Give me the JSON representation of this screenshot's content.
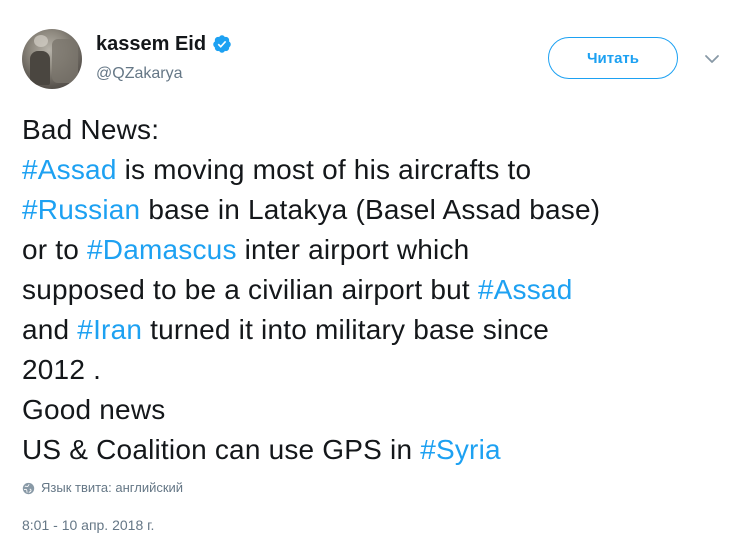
{
  "user": {
    "name": "kassem Eid",
    "handle": "@QZakarya"
  },
  "follow_button_label": "Читать",
  "tweet_lines": [
    [
      {
        "t": "Bad News:"
      }
    ],
    [
      {
        "t": "#Assad",
        "tag": true
      },
      {
        "t": " is moving most of his aircrafts to"
      }
    ],
    [
      {
        "t": "#Russian",
        "tag": true
      },
      {
        "t": " base in Latakya (Basel Assad base)"
      }
    ],
    [
      {
        "t": "or to "
      },
      {
        "t": "#Damascus",
        "tag": true
      },
      {
        "t": " inter airport which"
      }
    ],
    [
      {
        "t": "supposed to be a civilian airport but "
      },
      {
        "t": "#Assad",
        "tag": true
      }
    ],
    [
      {
        "t": "and "
      },
      {
        "t": "#Iran",
        "tag": true
      },
      {
        "t": " turned it into military base since"
      }
    ],
    [
      {
        "t": "2012 ."
      }
    ],
    [
      {
        "t": "Good news"
      }
    ],
    [
      {
        "t": "US & Coalition can use GPS in "
      },
      {
        "t": "#Syria",
        "tag": true
      }
    ]
  ],
  "language_note": "Язык твита: английский",
  "timestamp": "8:01 - 10 апр. 2018 г.",
  "colors": {
    "accent": "#1da1f2",
    "text": "#14171a",
    "secondary": "#657786"
  },
  "icons": {
    "verified": "verified-badge-icon",
    "caret": "chevron-down-icon",
    "globe": "globe-icon"
  }
}
